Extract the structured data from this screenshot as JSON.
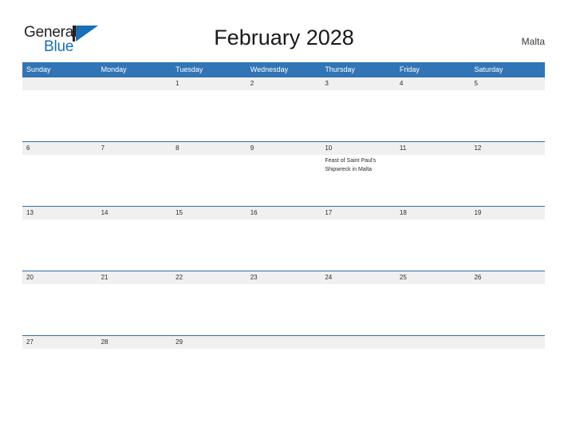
{
  "brand": {
    "name_part1": "General",
    "name_part2": "Blue",
    "logo_icon": "triangle-flag-icon",
    "color_primary": "#1a6fb5",
    "color_text": "#231f20"
  },
  "header": {
    "title": "February 2028",
    "country": "Malta"
  },
  "calendar": {
    "accent_color": "#3275b6",
    "band_color": "#f0f0f0",
    "border_color": "#2e6da4",
    "weekdays": [
      "Sunday",
      "Monday",
      "Tuesday",
      "Wednesday",
      "Thursday",
      "Friday",
      "Saturday"
    ],
    "weeks": [
      {
        "days": [
          {
            "num": "",
            "event": ""
          },
          {
            "num": "",
            "event": ""
          },
          {
            "num": "1",
            "event": ""
          },
          {
            "num": "2",
            "event": ""
          },
          {
            "num": "3",
            "event": ""
          },
          {
            "num": "4",
            "event": ""
          },
          {
            "num": "5",
            "event": ""
          }
        ]
      },
      {
        "days": [
          {
            "num": "6",
            "event": ""
          },
          {
            "num": "7",
            "event": ""
          },
          {
            "num": "8",
            "event": ""
          },
          {
            "num": "9",
            "event": ""
          },
          {
            "num": "10",
            "event": "Feast of Saint Paul's Shipwreck in Malta"
          },
          {
            "num": "11",
            "event": ""
          },
          {
            "num": "12",
            "event": ""
          }
        ]
      },
      {
        "days": [
          {
            "num": "13",
            "event": ""
          },
          {
            "num": "14",
            "event": ""
          },
          {
            "num": "15",
            "event": ""
          },
          {
            "num": "16",
            "event": ""
          },
          {
            "num": "17",
            "event": ""
          },
          {
            "num": "18",
            "event": ""
          },
          {
            "num": "19",
            "event": ""
          }
        ]
      },
      {
        "days": [
          {
            "num": "20",
            "event": ""
          },
          {
            "num": "21",
            "event": ""
          },
          {
            "num": "22",
            "event": ""
          },
          {
            "num": "23",
            "event": ""
          },
          {
            "num": "24",
            "event": ""
          },
          {
            "num": "25",
            "event": ""
          },
          {
            "num": "26",
            "event": ""
          }
        ]
      },
      {
        "days": [
          {
            "num": "27",
            "event": ""
          },
          {
            "num": "28",
            "event": ""
          },
          {
            "num": "29",
            "event": ""
          },
          {
            "num": "",
            "event": ""
          },
          {
            "num": "",
            "event": ""
          },
          {
            "num": "",
            "event": ""
          },
          {
            "num": "",
            "event": ""
          }
        ]
      }
    ]
  }
}
